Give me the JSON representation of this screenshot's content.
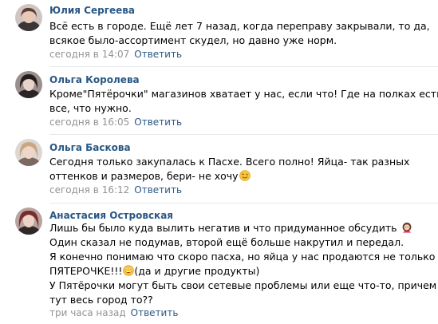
{
  "comments": [
    {
      "author": "Юлия Сергеева",
      "lines": [
        "Всё есть в городе. Ещё лет 7 назад, когда переправу закрывали, то да,",
        "всякое было-ассортимент скудел, но давно уже норм."
      ],
      "time": "сегодня в 14:07",
      "reply": "Ответить"
    },
    {
      "author": "Ольга Королева",
      "lines": [
        "Кроме\"Пятёрочки\" магазинов хватает у нас, если что! Где на полках есть",
        "все, что нужно."
      ],
      "time": "сегодня в 16:05",
      "reply": "Ответить"
    },
    {
      "author": "Ольга Баскова",
      "lines": [
        "Сегодня только закупалась к Пасхе. Всего полно! Яйца- так разных",
        "оттенков и размеров, бери- не хочу"
      ],
      "time": "сегодня в 16:12",
      "reply": "Ответить"
    },
    {
      "author": "Анастасия Островская",
      "lines": [
        "Лишь бы было куда вылить негатив и что придуманное обсудить",
        "Один сказал не подумав, второй ещё больше накрутил и передал.",
        "Я конечно понимаю что скоро пасха, но яйца у нас продаются не только в",
        "ПЯТЕРОЧКЕ!!!",
        "(да и другие продукты)",
        "У Пятёрочки могут быть свои сетевые проблемы или еще что-то, причем",
        "тут весь город то??"
      ],
      "time": "три часа назад",
      "reply": "Ответить"
    }
  ],
  "icons": {
    "wink": "winking-face-emoji",
    "woman": "woman-emoji",
    "grin": "grinning-face-emoji"
  },
  "colors": {
    "link": "#2a5885",
    "meta": "#939393",
    "divider": "#e7e8ec"
  }
}
